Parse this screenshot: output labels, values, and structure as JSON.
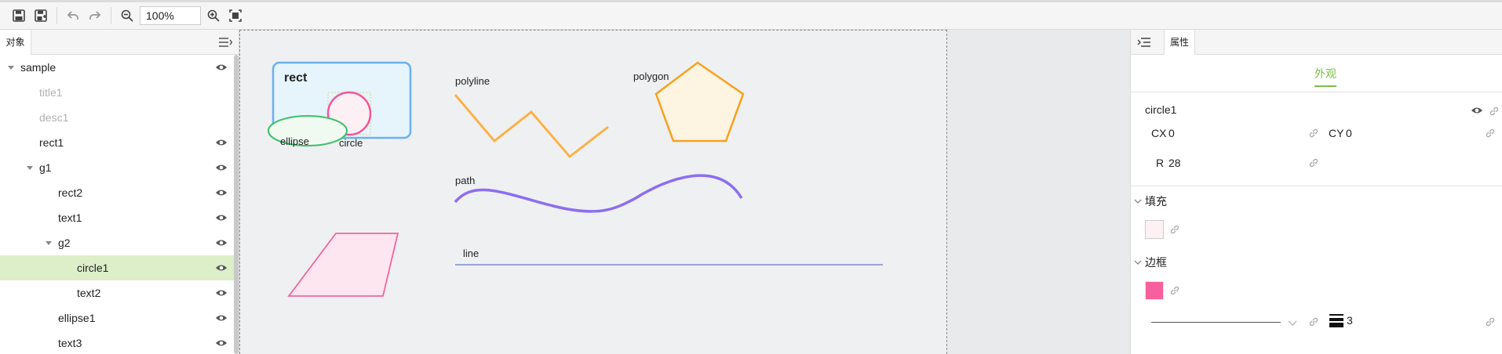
{
  "toolbar": {
    "zoom": "100%",
    "icons": [
      "save-icon",
      "save-as-icon",
      "undo-icon",
      "redo-icon",
      "zoom-out-icon",
      "zoom-in-icon",
      "fit-screen-icon"
    ]
  },
  "left_panel": {
    "tab": "对象",
    "tree": [
      {
        "label": "sample",
        "depth": 0,
        "arrow": "expanded",
        "muted": false,
        "eye": true
      },
      {
        "label": "title1",
        "depth": 1,
        "arrow": "none",
        "muted": true,
        "eye": false
      },
      {
        "label": "desc1",
        "depth": 1,
        "arrow": "none",
        "muted": true,
        "eye": false
      },
      {
        "label": "rect1",
        "depth": 1,
        "arrow": "none",
        "muted": false,
        "eye": true
      },
      {
        "label": "g1",
        "depth": 1,
        "arrow": "expanded",
        "muted": false,
        "eye": true
      },
      {
        "label": "rect2",
        "depth": 2,
        "arrow": "none",
        "muted": false,
        "eye": true
      },
      {
        "label": "text1",
        "depth": 2,
        "arrow": "none",
        "muted": false,
        "eye": true
      },
      {
        "label": "g2",
        "depth": 2,
        "arrow": "expanded",
        "muted": false,
        "eye": true
      },
      {
        "label": "circle1",
        "depth": 3,
        "arrow": "none",
        "muted": false,
        "eye": true,
        "selected": true
      },
      {
        "label": "text2",
        "depth": 3,
        "arrow": "none",
        "muted": false,
        "eye": true
      },
      {
        "label": "ellipse1",
        "depth": 2,
        "arrow": "none",
        "muted": false,
        "eye": true
      },
      {
        "label": "text3",
        "depth": 2,
        "arrow": "none",
        "muted": false,
        "eye": true
      }
    ]
  },
  "canvas": {
    "labels": {
      "rect": "rect",
      "ellipse": "ellipse",
      "circle": "circle",
      "polyline": "polyline",
      "polygon": "polygon",
      "path": "path",
      "line": "line"
    },
    "colors": {
      "rect_stroke": "#6ab0f0",
      "rect_fill": "#e6f4fb",
      "circle_stroke": "#f2559a",
      "circle_fill": "#fdf0f4",
      "ellipse_stroke": "#3cbf6b",
      "ellipse_fill": "#f0faf1",
      "polyline": "#fbb247",
      "polygon_stroke": "#f6a21e",
      "polygon_fill": "#fdf4e2",
      "path": "#8c6ef0",
      "line": "#9aa4d9",
      "parallelogram_stroke": "#f0679a",
      "parallelogram_fill": "#fde6f0"
    }
  },
  "right_panel": {
    "tab": "属性",
    "subtab": "外观",
    "element_name": "circle1",
    "cx_label": "CX",
    "cx_value": "0",
    "cy_label": "CY",
    "cy_value": "0",
    "r_label": "R",
    "r_value": "28",
    "fill_section": "填充",
    "fill_color": "#fdf1f4",
    "stroke_section": "边框",
    "stroke_color": "#f7609c",
    "stroke_width": "3"
  }
}
